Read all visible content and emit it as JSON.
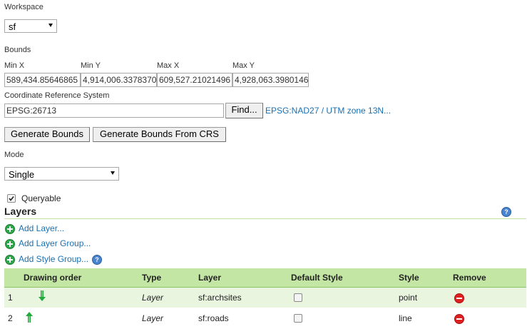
{
  "workspace": {
    "label": "Workspace",
    "value": "sf"
  },
  "bounds": {
    "label": "Bounds",
    "fields": [
      {
        "label": "Min X",
        "value": "589,434.85646865"
      },
      {
        "label": "Min Y",
        "value": "4,914,006.3378370"
      },
      {
        "label": "Max X",
        "value": "609,527.21021496"
      },
      {
        "label": "Max Y",
        "value": "4,928,063.3980146"
      }
    ]
  },
  "crs": {
    "label": "Coordinate Reference System",
    "value": "EPSG:26713",
    "find_label": "Find...",
    "link_text": "EPSG:NAD27 / UTM zone 13N..."
  },
  "actions": {
    "generate_bounds": "Generate Bounds",
    "generate_bounds_crs": "Generate Bounds From CRS"
  },
  "mode": {
    "label": "Mode",
    "value": "Single"
  },
  "queryable": {
    "label": "Queryable",
    "checked": true
  },
  "layers": {
    "title": "Layers",
    "add_layer": "Add Layer...",
    "add_layer_group": "Add Layer Group...",
    "add_style_group": "Add Style Group...",
    "columns": [
      "Drawing order",
      "Type",
      "Layer",
      "Default Style",
      "Style",
      "Remove"
    ],
    "rows": [
      {
        "order": "1",
        "type": "Layer",
        "layer": "sf:archsites",
        "style": "point",
        "arrow": "down"
      },
      {
        "order": "2",
        "type": "Layer",
        "layer": "sf:roads",
        "style": "line",
        "arrow": "up"
      }
    ]
  },
  "colors": {
    "accent_green": "#c3e6a4",
    "link_blue": "#1a6fb0",
    "header_rule": "#8bc34a"
  }
}
